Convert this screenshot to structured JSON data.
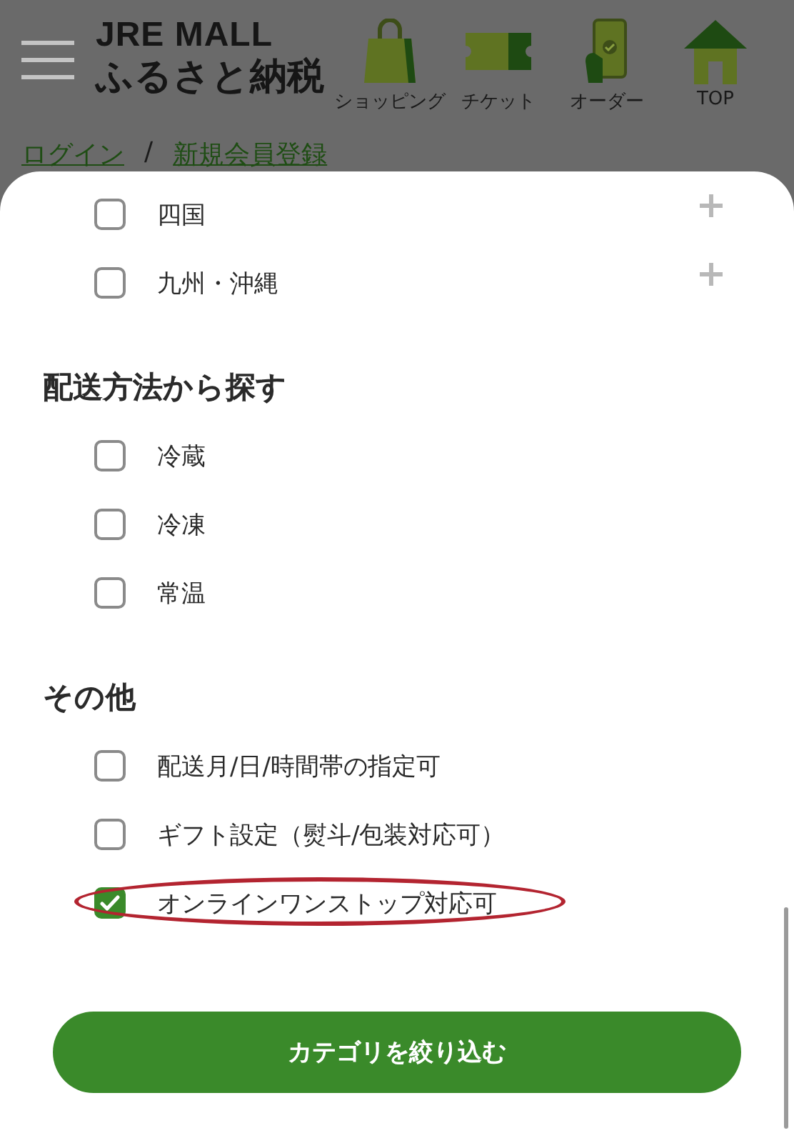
{
  "header": {
    "logo_line1": "JRE MALL",
    "logo_line2": "ふるさと納税",
    "nav": [
      {
        "kind": "bag",
        "label": "ショッピング"
      },
      {
        "kind": "ticket",
        "label": "チケット"
      },
      {
        "kind": "phone",
        "label": "オーダー"
      },
      {
        "kind": "house",
        "label": "TOP"
      }
    ]
  },
  "breadcrumb": {
    "items": [
      {
        "label": "ログイン"
      },
      {
        "label": "新規会員登録"
      }
    ],
    "separator": "/"
  },
  "filter_sheet": {
    "groups": [
      {
        "items": [
          {
            "label": "四国",
            "checked": false,
            "expandable": true,
            "highlighted": false
          },
          {
            "label": "九州・沖縄",
            "checked": false,
            "expandable": true,
            "highlighted": false
          }
        ]
      },
      {
        "heading": "配送方法から探す",
        "items": [
          {
            "label": "冷蔵",
            "checked": false,
            "expandable": false,
            "highlighted": false
          },
          {
            "label": "冷凍",
            "checked": false,
            "expandable": false,
            "highlighted": false
          },
          {
            "label": "常温",
            "checked": false,
            "expandable": false,
            "highlighted": false
          }
        ]
      },
      {
        "heading": "その他",
        "items": [
          {
            "label": "配送月/日/時間帯の指定可",
            "checked": false,
            "expandable": false,
            "highlighted": false
          },
          {
            "label": "ギフト設定（熨斗/包装対応可）",
            "checked": false,
            "expandable": false,
            "highlighted": false
          },
          {
            "label": "オンラインワンストップ対応可",
            "checked": true,
            "expandable": false,
            "highlighted": true
          }
        ]
      }
    ],
    "apply_button": "カテゴリを絞り込む"
  }
}
